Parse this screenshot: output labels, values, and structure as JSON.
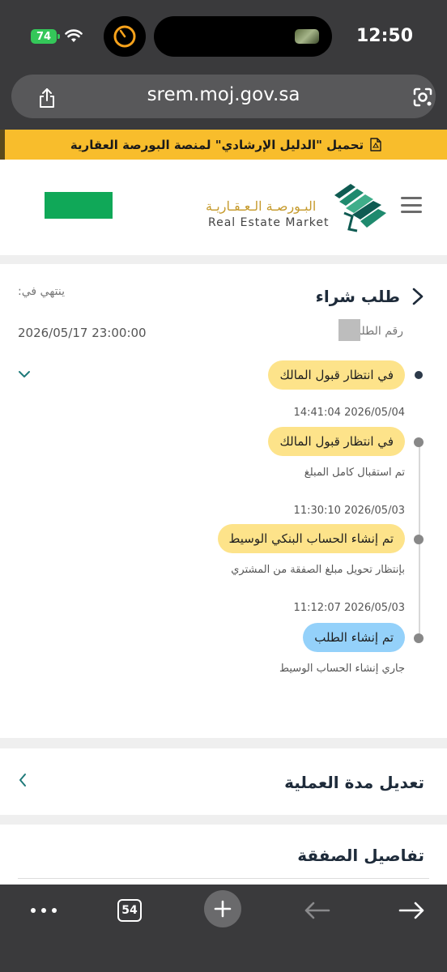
{
  "status_bar": {
    "battery": "74",
    "time": "12:50"
  },
  "browser": {
    "url": "srem.moj.gov.sa",
    "tabs_count": "54"
  },
  "banner": {
    "text": "تحميل \"الدليل الإرشادي\" لمنصة البورصة العقارية"
  },
  "header": {
    "logo_ar": "البـورصـة الـعـقـاريـة",
    "logo_en": "Real Estate Market"
  },
  "request": {
    "title": "طلب شراء",
    "expires_label": "ينتهي في:",
    "order_number_label": "رقم الطلب",
    "expiry_date": "2026/05/17 23:00:00",
    "current_status": "في انتظار قبول المالك",
    "timeline": [
      {
        "timestamp": "14:41:04 2026/05/04",
        "status": "في انتظار قبول المالك",
        "note": "تم استقبال كامل المبلغ",
        "color": "#fde38a"
      },
      {
        "timestamp": "11:30:10 2026/05/03",
        "status": "تم إنشاء الحساب البنكي الوسيط",
        "note": "بإنتظار تحويل مبلغ الصفقة من المشتري",
        "color": "#fde38a"
      },
      {
        "timestamp": "11:12:07 2026/05/03",
        "status": "تم إنشاء الطلب",
        "note": "جاري إنشاء الحساب الوسيط",
        "color": "#94d1fa"
      }
    ]
  },
  "sections": {
    "edit_duration": "تعديل مدة العملية",
    "deal_details": "تفاصيل الصفقة"
  },
  "colors": {
    "banner": "#f8bd2c",
    "brand_green": "#10a858",
    "brand_gold": "#c69b2e",
    "pill_yellow": "#fde38a",
    "pill_blue": "#94d1fa"
  }
}
